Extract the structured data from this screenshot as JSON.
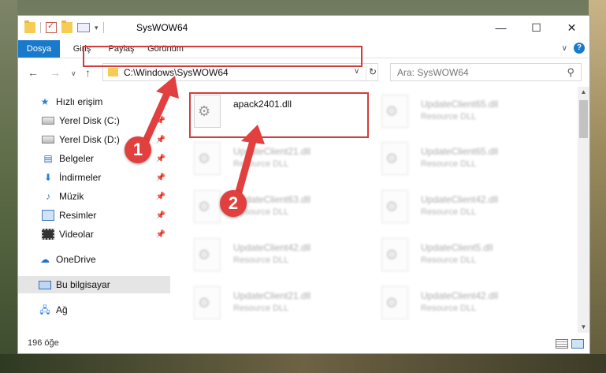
{
  "window": {
    "title": "SysWOW64",
    "qat_arrow": "▾",
    "controls": {
      "minimize": "—",
      "maximize": "☐",
      "close": "✕"
    }
  },
  "ribbon": {
    "tabs": [
      "Dosya",
      "Giriş",
      "Paylaş",
      "Görünüm"
    ],
    "file_tab_color": "#1979ca"
  },
  "nav": {
    "back": "←",
    "forward": "→",
    "recent": "∨",
    "up": "↑",
    "address": "C:\\Windows\\SysWOW64",
    "address_dropdown": "∨",
    "refresh": "↻",
    "search_placeholder": "Ara: SysWOW64"
  },
  "sidebar": {
    "items": [
      {
        "label": "Hızlı erişim",
        "icon": "star-icon"
      },
      {
        "label": "Yerel Disk (C:)",
        "icon": "drive-icon",
        "pinned": true
      },
      {
        "label": "Yerel Disk (D:)",
        "icon": "drive-icon",
        "pinned": true
      },
      {
        "label": "Belgeler",
        "icon": "documents-icon",
        "pinned": true
      },
      {
        "label": "İndirmeler",
        "icon": "downloads-icon",
        "pinned": true
      },
      {
        "label": "Müzik",
        "icon": "music-icon",
        "pinned": true
      },
      {
        "label": "Resimler",
        "icon": "pictures-icon",
        "pinned": true
      },
      {
        "label": "Videolar",
        "icon": "videos-icon",
        "pinned": true
      },
      {
        "label": "OneDrive",
        "icon": "onedrive-icon"
      },
      {
        "label": "Bu bilgisayar",
        "icon": "computer-icon",
        "selected": true
      },
      {
        "label": "Ağ",
        "icon": "network-icon"
      }
    ]
  },
  "files": [
    {
      "name": "apack2401.dll",
      "type": "",
      "highlighted": true
    },
    {
      "name": "UpdateClient65.dll",
      "type": "Resource DLL"
    },
    {
      "name": "UpdateClient21.dll",
      "type": "Resource DLL"
    },
    {
      "name": "UpdateClient65.dll",
      "type": "Resource DLL"
    },
    {
      "name": "UpdateClient63.dll",
      "type": "Resource DLL"
    },
    {
      "name": "UpdateClient42.dll",
      "type": "Resource DLL"
    },
    {
      "name": "UpdateClient42.dll",
      "type": "Resource DLL"
    },
    {
      "name": "UpdateClient5.dll",
      "type": "Resource DLL"
    },
    {
      "name": "UpdateClient21.dll",
      "type": "Resource DLL"
    },
    {
      "name": "UpdateClient42.dll",
      "type": "Resource DLL"
    }
  ],
  "status": {
    "item_count": "196 öğe"
  },
  "annotations": {
    "step1": "1",
    "step2": "2",
    "color": "#e23f3f"
  }
}
